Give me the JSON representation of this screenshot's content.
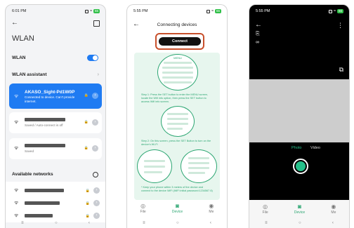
{
  "screen1": {
    "time": "6:01 PM",
    "battery": "66",
    "title": "WLAN",
    "wlan_label": "WLAN",
    "assistant_label": "WLAN assistant",
    "connected_network": {
      "name": "AKASO_Sight-Pd1W0P",
      "status": "Connected to device. Can't provide internet."
    },
    "saved_network_1": {
      "status": "Saved / Auto-connect is off"
    },
    "saved_network_2": {
      "status": "Saved"
    },
    "available_title": "Available networks"
  },
  "screen2": {
    "time": "5:55 PM",
    "battery": "66",
    "title": "Connecting devices",
    "connect_label": "Connect",
    "menu_label": "MENU",
    "step1": "Step 1: Press the SET button to enter the MENU screen, locate the Wifi info option, then press the SET button to access Wifi info screen.",
    "step2": "Step 2: On this screen, press the SET Button to turn on the device's Wi-Fi",
    "step3": "* Keep your phone within 3 meters of the device and connect to the device WiFi (WiFi initial password:1234567 8)",
    "tabs": [
      "File",
      "Device",
      "Me"
    ]
  },
  "screen3": {
    "time": "5:55 PM",
    "modes": [
      "Photo",
      "Video"
    ],
    "tabs": [
      "File",
      "Device",
      "Me"
    ]
  },
  "colors": {
    "accent_blue": "#1f7bf2",
    "accent_green": "#2ca672",
    "highlight": "#c8502c"
  }
}
